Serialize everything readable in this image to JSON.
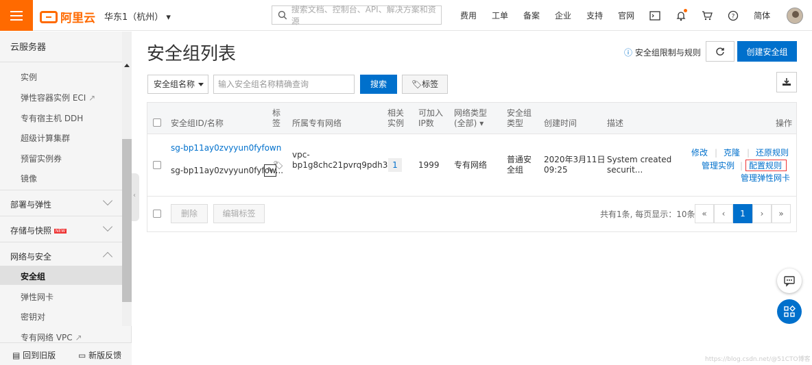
{
  "header": {
    "logo_text": "阿里云",
    "region": "华东1（杭州）",
    "search_placeholder": "搜索文档、控制台、API、解决方案和资源",
    "nav": [
      "费用",
      "工单",
      "备案",
      "企业",
      "支持",
      "官网"
    ],
    "lang": "简体",
    "brand_color": "#ff6a00"
  },
  "sidebar": {
    "title": "云服务器",
    "items": [
      "实例",
      "弹性容器实例 ECI",
      "专有宿主机 DDH",
      "超级计算集群",
      "预留实例券",
      "镜像"
    ],
    "groups": [
      "部署与弹性",
      "存储与快照",
      "网络与安全"
    ],
    "new_badge": "NEW",
    "net_items": [
      "安全组",
      "弹性网卡",
      "密钥对",
      "专有网络 VPC"
    ],
    "bottom": [
      "回到旧版",
      "新版反馈"
    ]
  },
  "page": {
    "title": "安全组列表",
    "limit_link": "安全组限制与规则",
    "create_button": "创建安全组"
  },
  "filter": {
    "select_value": "安全组名称",
    "input_placeholder": "输入安全组名称精确查询",
    "search_button": "搜索",
    "tag_button": "标签"
  },
  "table": {
    "headers": [
      "安全组ID/名称",
      "标签",
      "所属专有网络",
      "相关实例",
      "可加入IP数",
      "网络类型(全部)",
      "安全组类型",
      "创建时间",
      "描述",
      "操作"
    ],
    "row": {
      "id": "sg-bp11ay0zvyyun0fyfown",
      "name": "sg-bp11ay0zvyyun0fyfow...",
      "vpc_line1": "vpc-",
      "vpc_line2": "bp1g8chc21pvrq9pdh3ks",
      "instances": "1",
      "ip_count": "1999",
      "net_type": "专有网络",
      "sg_type_line1": "普通安",
      "sg_type_line2": "全组",
      "created_line1": "2020年3月11日",
      "created_line2": "09:25",
      "desc_line1": "System created",
      "desc_line2": "securit...",
      "actions": [
        "修改",
        "克隆",
        "还原规则",
        "管理实例",
        "配置规则",
        "管理弹性网卡"
      ]
    },
    "delete_button": "删除",
    "edit_tag_button": "编辑标签",
    "summary": "共有1条, 每页显示：10条",
    "pages": [
      "«",
      "‹",
      "1",
      "›",
      "»"
    ]
  },
  "accent_color": "#0070cc",
  "watermark": "https://blog.csdn.net/@51CTO博客"
}
